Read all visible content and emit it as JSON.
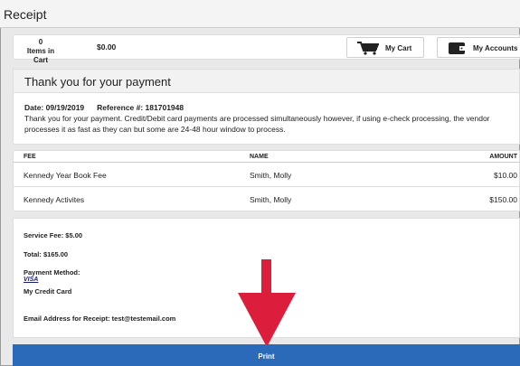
{
  "page": {
    "title": "Receipt"
  },
  "cart": {
    "count": "0",
    "count_label": "Items in Cart",
    "total": "$0.00",
    "my_cart_label": "My Cart",
    "my_accounts_label": "My Accounts"
  },
  "thanks": {
    "heading": "Thank you for your payment",
    "date": "Date: 09/19/2019",
    "reference": "Reference #: 181701948",
    "message": "Thank you for your payment.  Credit/Debit card payments are processed simultaneously however, if using e-check processing, the vendor processes it as fast as they can but some are 24-48 hour window to process."
  },
  "table": {
    "headers": {
      "fee": "FEE",
      "name": "NAME",
      "amount": "AMOUNT"
    },
    "rows": [
      {
        "fee": "Kennedy Year Book Fee",
        "name": "Smith, Molly",
        "amount": "$10.00"
      },
      {
        "fee": "Kennedy Activites",
        "name": "Smith, Molly",
        "amount": "$150.00"
      }
    ]
  },
  "summary": {
    "service_fee": "Service Fee: $5.00",
    "total": "Total: $165.00",
    "payment_method_label": "Payment Method:",
    "card_brand": "VISA",
    "card_name": "My Credit Card",
    "email": "Email Address for Receipt: test@testemail.com"
  },
  "actions": {
    "print_label": "Print"
  },
  "colors": {
    "primary_button": "#2a6ab8",
    "annotation_arrow": "#dc1e3c",
    "visa_blue": "#1a1f71"
  },
  "icons": {
    "cart": "shopping-cart-icon",
    "accounts": "wallet-icon"
  }
}
